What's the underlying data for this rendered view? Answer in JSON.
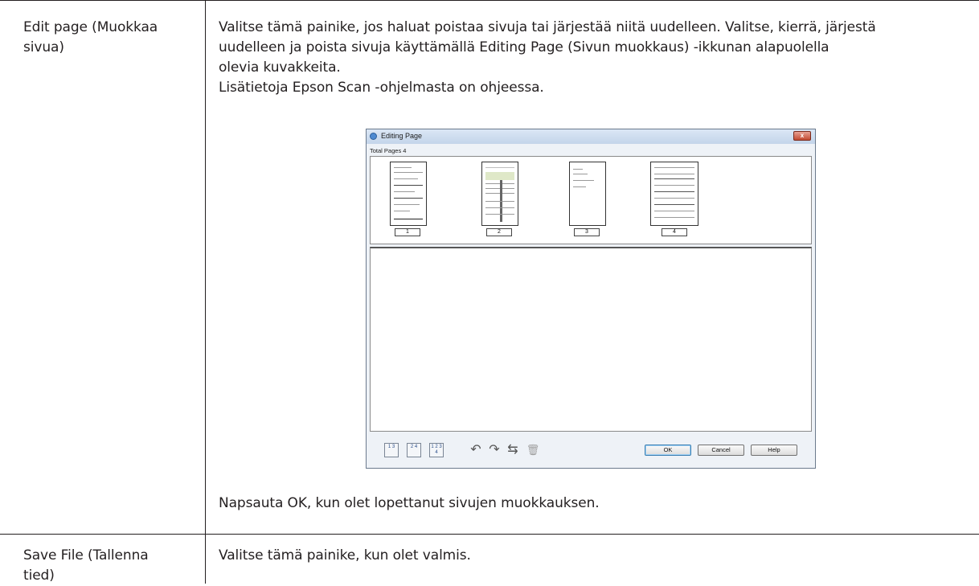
{
  "rows": [
    {
      "term_lines": [
        "Edit page (Muokkaa",
        "sivua)"
      ],
      "description_lines": [
        "Valitse tämä painike, jos haluat poistaa sivuja tai järjestää niitä uudelleen. Valitse, kierrä, järjestä",
        "uudelleen ja poista sivuja käyttämällä Editing Page (Sivun muokkaus) -ikkunan alapuolella",
        "olevia kuvakkeita.",
        "Lisätietoja Epson Scan -ohjelmasta on ohjeessa."
      ],
      "after_screenshot": "Napsauta OK, kun olet lopettanut sivujen muokkauksen."
    },
    {
      "term_lines": [
        "Save File (Tallenna",
        "tied)"
      ],
      "description_lines": [
        "Valitse tämä painike, kun olet valmis."
      ]
    }
  ],
  "dialog": {
    "title": "Editing Page",
    "close_glyph": "x",
    "total_pages_label": "Total Pages 4",
    "pages": [
      "1",
      "2",
      "3",
      "4"
    ],
    "toolbar_icons": [
      {
        "name": "select-odd-pages-icon",
        "text": "1 3",
        "glyph": ""
      },
      {
        "name": "select-even-pages-icon",
        "text": "2 4",
        "glyph": ""
      },
      {
        "name": "select-all-pages-icon",
        "text": "1 2 3 4",
        "glyph": ""
      },
      {
        "name": "rotate-left-icon",
        "text": "",
        "glyph": "↶"
      },
      {
        "name": "rotate-right-icon",
        "text": "",
        "glyph": "↷"
      },
      {
        "name": "reorder-pages-icon",
        "text": "",
        "glyph": "⇆"
      },
      {
        "name": "delete-page-icon",
        "text": "",
        "glyph": "🗑"
      }
    ],
    "buttons": {
      "ok": "OK",
      "cancel": "Cancel",
      "help": "Help"
    }
  }
}
